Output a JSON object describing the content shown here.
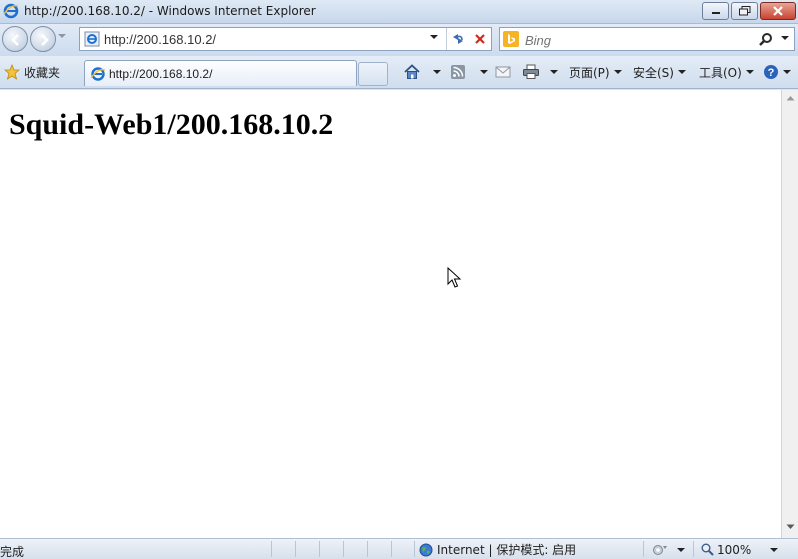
{
  "window": {
    "title": "http://200.168.10.2/ - Windows Internet Explorer"
  },
  "navigation": {
    "address_value": "http://200.168.10.2/",
    "search_placeholder": "Bing"
  },
  "favorites_bar": {
    "favorites_label": "收藏夹",
    "tab_label": "http://200.168.10.2/"
  },
  "command_bar": {
    "page_menu": "页面(P)",
    "safety_menu": "安全(S)",
    "tools_menu": "工具(O)"
  },
  "page": {
    "heading": "Squid-Web1/200.168.10.2"
  },
  "status_bar": {
    "status": "完成",
    "zone": "Internet | 保护模式: 启用",
    "zoom": "100%"
  },
  "colors": {
    "chrome_blue": "#dbe5f1",
    "close_red": "#c9432f",
    "ie_icon_blue": "#1e6fd0",
    "bing_orange": "#f6b324"
  },
  "icons": [
    "ie-icon",
    "back-icon",
    "forward-icon",
    "refresh-icon",
    "stop-icon",
    "bing-icon",
    "search-icon",
    "favorites-star-icon",
    "home-icon",
    "feeds-icon",
    "mail-icon",
    "print-icon",
    "help-icon",
    "globe-icon",
    "zoom-icon",
    "mouse-cursor-icon"
  ]
}
